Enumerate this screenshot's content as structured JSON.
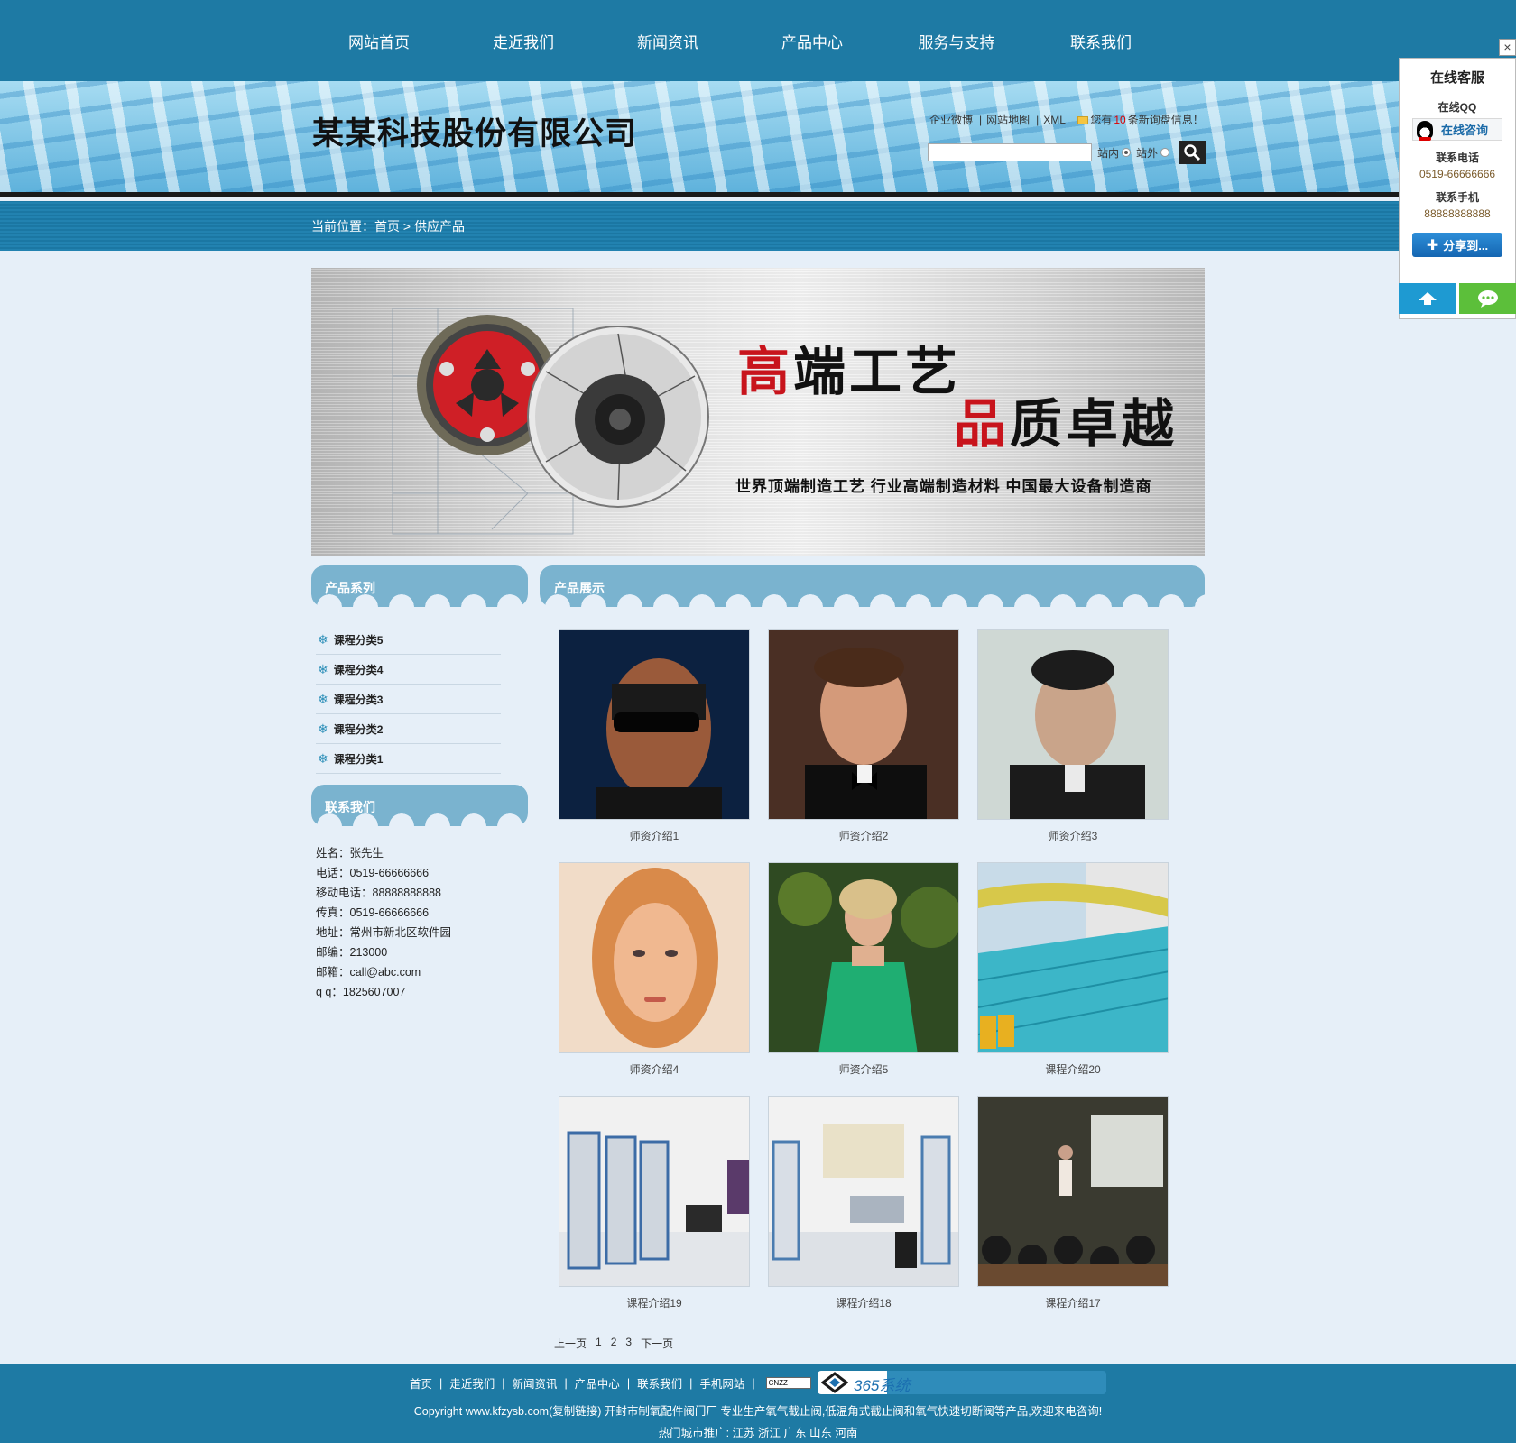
{
  "nav": [
    "网站首页",
    "走近我们",
    "新闻资讯",
    "产品中心",
    "服务与支持",
    "联系我们"
  ],
  "header": {
    "company_name": "某某科技股份有限公司",
    "links": [
      "企业微博",
      "网站地图",
      "XML"
    ],
    "inquiry_prefix": "您有",
    "inquiry_count": "10",
    "inquiry_suffix": "条新询盘信息！",
    "search": {
      "value": "",
      "site_in": "站内",
      "site_out": "站外"
    }
  },
  "breadcrumb": "当前位置：首页 > 供应产品",
  "banner": {
    "line1_red": "高",
    "line1_rest": "端工艺",
    "line2_red": "品",
    "line2_rest": "质卓越",
    "subtitle": "世界顶端制造工艺  行业高端制造材料  中国最大设备制造商"
  },
  "sidebar": {
    "categories_title": "产品系列",
    "categories": [
      "课程分类5",
      "课程分类4",
      "课程分类3",
      "课程分类2",
      "课程分类1"
    ],
    "contact_title": "联系我们",
    "contact": [
      "姓名：张先生",
      "电话：0519-66666666",
      "移动电话：88888888888",
      "传真：0519-66666666",
      "地址：常州市新北区软件园",
      "邮编：213000",
      "邮箱：call@abc.com",
      "q q：1825607007"
    ]
  },
  "products": {
    "title": "产品展示",
    "items": [
      {
        "caption": "师资介绍1",
        "image": "man-sunglasses-portrait"
      },
      {
        "caption": "师资介绍2",
        "image": "man-bowtie-portrait"
      },
      {
        "caption": "师资介绍3",
        "image": "man-suit-portrait"
      },
      {
        "caption": "师资介绍4",
        "image": "woman-blonde-portrait"
      },
      {
        "caption": "师资介绍5",
        "image": "woman-green-dress"
      },
      {
        "caption": "课程介绍20",
        "image": "swimming-pool"
      },
      {
        "caption": "课程介绍19",
        "image": "equipment-lab"
      },
      {
        "caption": "课程介绍18",
        "image": "training-room"
      },
      {
        "caption": "课程介绍17",
        "image": "lecture-classroom"
      }
    ]
  },
  "pager": [
    "上一页",
    "1",
    "2",
    "3",
    "下一页"
  ],
  "footer": {
    "links": [
      "首页",
      "走近我们",
      "新闻资讯",
      "产品中心",
      "联系我们",
      "手机网站"
    ],
    "cnzz": "CNZZ",
    "badge": "365系统",
    "copyright": "Copyright www.kfzysb.com(复制链接) 开封市制氧配件阀门厂 专业生产氧气截止阀,低温角式截止阀和氧气快速切断阀等产品,欢迎来电咨询!",
    "hot_cities": "热门城市推广: 江苏 浙江 广东 山东 河南"
  },
  "side_widget": {
    "title": "在线客服",
    "qq_label": "在线QQ",
    "qq_button": "在线咨询",
    "phone_label": "联系电话",
    "phone": "0519-66666666",
    "mobile_label": "联系手机",
    "mobile": "88888888888",
    "share": "分享到..."
  }
}
